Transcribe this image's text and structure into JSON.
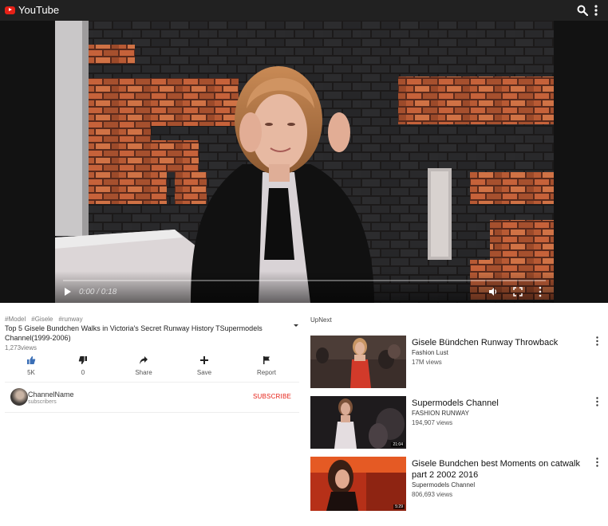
{
  "app": {
    "name": "YouTube"
  },
  "icons": {
    "logo": "youtube-logo-icon",
    "search": "search-icon",
    "menu": "more-vert-icon",
    "play": "play-icon",
    "volume": "volume-icon",
    "fullscreen": "fullscreen-icon",
    "like": "thumb-up-icon",
    "dislike": "thumb-down-icon",
    "share": "share-icon",
    "save": "add-icon",
    "report": "flag-icon"
  },
  "player": {
    "time": "0:00 / 0:18",
    "progress": 0
  },
  "video": {
    "tags": [
      "#Model",
      "#Gisele",
      "#runway"
    ],
    "title": "Top 5 Gisele Bundchen Walks in Victoria's Secret Runway History TSupermodels Channel(1999-2006)",
    "views": "1,273views"
  },
  "actions": [
    {
      "label": "5K"
    },
    {
      "label": "0"
    },
    {
      "label": "Share"
    },
    {
      "label": "Save"
    },
    {
      "label": "Report"
    }
  ],
  "channel": {
    "name": "ChannelName",
    "subscribers": "subscribers",
    "subscribe_label": "SUBSCRIBE"
  },
  "upnext": {
    "heading": "UpNext",
    "items": [
      {
        "title": "Gisele Bündchen Runway Throwback",
        "channel": "Fashion Lust",
        "views": "17M views"
      },
      {
        "title": "Supermodels Channel",
        "channel": "FASHION RUNWAY",
        "views": "194,907 views",
        "duration": "21:04"
      },
      {
        "title": "Gisele Bundchen best Moments on catwalk part 2 2002 2016",
        "channel": "Supermodels Channel",
        "views": "806,693 views",
        "duration": "5:29"
      }
    ]
  },
  "colors": {
    "topbar": "#212121",
    "brand_red": "#e62117",
    "subscribe": "#e62117"
  }
}
